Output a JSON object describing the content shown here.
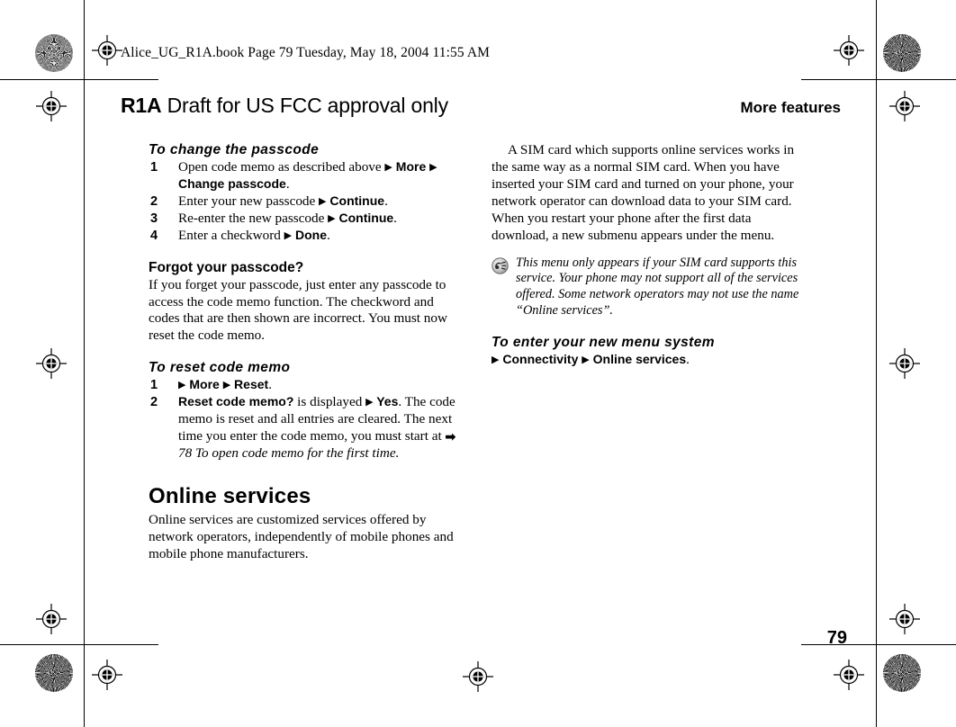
{
  "print_marks": {
    "header_slug": "Alice_UG_R1A.book  Page 79  Tuesday, May 18, 2004  11:55 AM"
  },
  "title_bar": {
    "code": "R1A",
    "draft_notice": "Draft for US FCC approval only",
    "chapter": "More features"
  },
  "left_column": {
    "procedure_change_passcode": {
      "heading": "To change the passcode",
      "steps": [
        {
          "number": "1",
          "parts": [
            {
              "type": "text",
              "value": "Open code memo as described above "
            },
            {
              "type": "arrow",
              "value": "▶"
            },
            {
              "type": "ui",
              "value": " More "
            },
            {
              "type": "arrow",
              "value": "▶"
            },
            {
              "type": "ui",
              "value": " Change passcode"
            },
            {
              "type": "text",
              "value": "."
            }
          ]
        },
        {
          "number": "2",
          "parts": [
            {
              "type": "text",
              "value": "Enter your new passcode "
            },
            {
              "type": "arrow",
              "value": "▶"
            },
            {
              "type": "ui",
              "value": " Continue"
            },
            {
              "type": "text",
              "value": "."
            }
          ]
        },
        {
          "number": "3",
          "parts": [
            {
              "type": "text",
              "value": "Re-enter the new passcode "
            },
            {
              "type": "arrow",
              "value": "▶"
            },
            {
              "type": "ui",
              "value": " Continue"
            },
            {
              "type": "text",
              "value": "."
            }
          ]
        },
        {
          "number": "4",
          "parts": [
            {
              "type": "text",
              "value": "Enter a checkword "
            },
            {
              "type": "arrow",
              "value": "▶"
            },
            {
              "type": "ui",
              "value": " Done"
            },
            {
              "type": "text",
              "value": "."
            }
          ]
        }
      ]
    },
    "forgot_passcode": {
      "heading": "Forgot your passcode?",
      "body": "If you forget your passcode, just enter any passcode to access the code memo function. The checkword and codes that are then shown are incorrect. You must now reset the code memo."
    },
    "procedure_reset_code_memo": {
      "heading": "To reset code memo",
      "step1": {
        "number": "1",
        "arrow1": "▶",
        "ui1": " More ",
        "arrow2": "▶",
        "ui2": " Reset",
        "period": "."
      },
      "step2": {
        "number": "2",
        "ui_dialog": "Reset code memo?",
        "text_a": " is displayed ",
        "arrow": "▶",
        "ui_yes": " Yes",
        "text_b": ". The code memo is reset and all entries are cleared. The next time you enter the code memo, you must start at ",
        "xref_arrow": "➡",
        "xref": " 78 To open code memo for the first time."
      }
    },
    "online_services": {
      "heading": "Online services",
      "body": "Online services are customized services offered by network operators, independently of mobile phones and mobile phone manufacturers."
    }
  },
  "right_column": {
    "intro_paragraph": "A SIM card which supports online services works in the same way as a normal SIM card. When you have inserted your SIM card and turned on your phone, your network operator can download data to your SIM card. When you restart your phone after the first data download, a new submenu appears under the menu.",
    "note": {
      "icon": "note-tip-icon",
      "text": "This menu only appears if your SIM card supports this service. Your phone may not support all of the services offered. Some network operators may not use the name “Online services”."
    },
    "procedure_enter_menu_system": {
      "heading": "To enter your new menu system",
      "arrow1": "▶",
      "ui1": " Connectivity ",
      "arrow2": "▶",
      "ui2": " Online services",
      "period": "."
    }
  },
  "folio": {
    "page_number": "79"
  }
}
